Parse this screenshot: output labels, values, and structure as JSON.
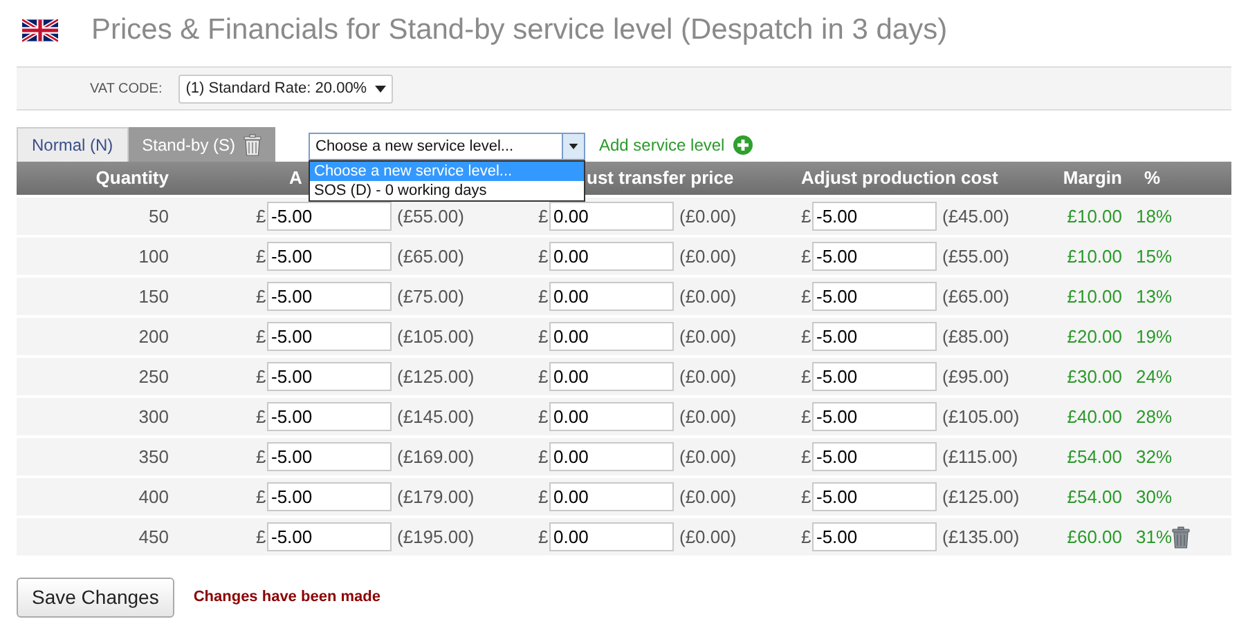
{
  "title": "Prices & Financials for Stand-by service level (Despatch in 3 days)",
  "vat": {
    "label": "VAT CODE:",
    "value": "(1) Standard Rate: 20.00%"
  },
  "tabs": [
    {
      "label": "Normal (N)",
      "selected": false,
      "deletable": false
    },
    {
      "label": "Stand-by (S)",
      "selected": true,
      "deletable": true
    }
  ],
  "service_select": {
    "value": "Choose a new service level...",
    "expanded": true,
    "options": [
      {
        "label": "Choose a new service level...",
        "selected": true
      },
      {
        "label": "SOS (D) - 0 working days",
        "selected": false
      }
    ]
  },
  "add_link": "Add service level",
  "table": {
    "columns": [
      "Quantity",
      "A",
      "ust transfer price",
      "Adjust production cost",
      "Margin",
      "%"
    ],
    "rows": [
      {
        "quantity": "50",
        "currency": "£",
        "price_adjust": "-5.00",
        "price": "(£55.00)",
        "transfer_adjust": "0.00",
        "transfer": "(£0.00)",
        "production_adjust": "-5.00",
        "production": "(£45.00)",
        "margin": "£10.00",
        "percent": "18%",
        "deletable": false
      },
      {
        "quantity": "100",
        "currency": "£",
        "price_adjust": "-5.00",
        "price": "(£65.00)",
        "transfer_adjust": "0.00",
        "transfer": "(£0.00)",
        "production_adjust": "-5.00",
        "production": "(£55.00)",
        "margin": "£10.00",
        "percent": "15%",
        "deletable": false
      },
      {
        "quantity": "150",
        "currency": "£",
        "price_adjust": "-5.00",
        "price": "(£75.00)",
        "transfer_adjust": "0.00",
        "transfer": "(£0.00)",
        "production_adjust": "-5.00",
        "production": "(£65.00)",
        "margin": "£10.00",
        "percent": "13%",
        "deletable": false
      },
      {
        "quantity": "200",
        "currency": "£",
        "price_adjust": "-5.00",
        "price": "(£105.00)",
        "transfer_adjust": "0.00",
        "transfer": "(£0.00)",
        "production_adjust": "-5.00",
        "production": "(£85.00)",
        "margin": "£20.00",
        "percent": "19%",
        "deletable": false
      },
      {
        "quantity": "250",
        "currency": "£",
        "price_adjust": "-5.00",
        "price": "(£125.00)",
        "transfer_adjust": "0.00",
        "transfer": "(£0.00)",
        "production_adjust": "-5.00",
        "production": "(£95.00)",
        "margin": "£30.00",
        "percent": "24%",
        "deletable": false
      },
      {
        "quantity": "300",
        "currency": "£",
        "price_adjust": "-5.00",
        "price": "(£145.00)",
        "transfer_adjust": "0.00",
        "transfer": "(£0.00)",
        "production_adjust": "-5.00",
        "production": "(£105.00)",
        "margin": "£40.00",
        "percent": "28%",
        "deletable": false
      },
      {
        "quantity": "350",
        "currency": "£",
        "price_adjust": "-5.00",
        "price": "(£169.00)",
        "transfer_adjust": "0.00",
        "transfer": "(£0.00)",
        "production_adjust": "-5.00",
        "production": "(£115.00)",
        "margin": "£54.00",
        "percent": "32%",
        "deletable": false
      },
      {
        "quantity": "400",
        "currency": "£",
        "price_adjust": "-5.00",
        "price": "(£179.00)",
        "transfer_adjust": "0.00",
        "transfer": "(£0.00)",
        "production_adjust": "-5.00",
        "production": "(£125.00)",
        "margin": "£54.00",
        "percent": "30%",
        "deletable": false
      },
      {
        "quantity": "450",
        "currency": "£",
        "price_adjust": "-5.00",
        "price": "(£195.00)",
        "transfer_adjust": "0.00",
        "transfer": "(£0.00)",
        "production_adjust": "-5.00",
        "production": "(£135.00)",
        "margin": "£60.00",
        "percent": "31%",
        "deletable": true
      }
    ]
  },
  "save_button": "Save Changes",
  "status_message": "Changes have been made"
}
